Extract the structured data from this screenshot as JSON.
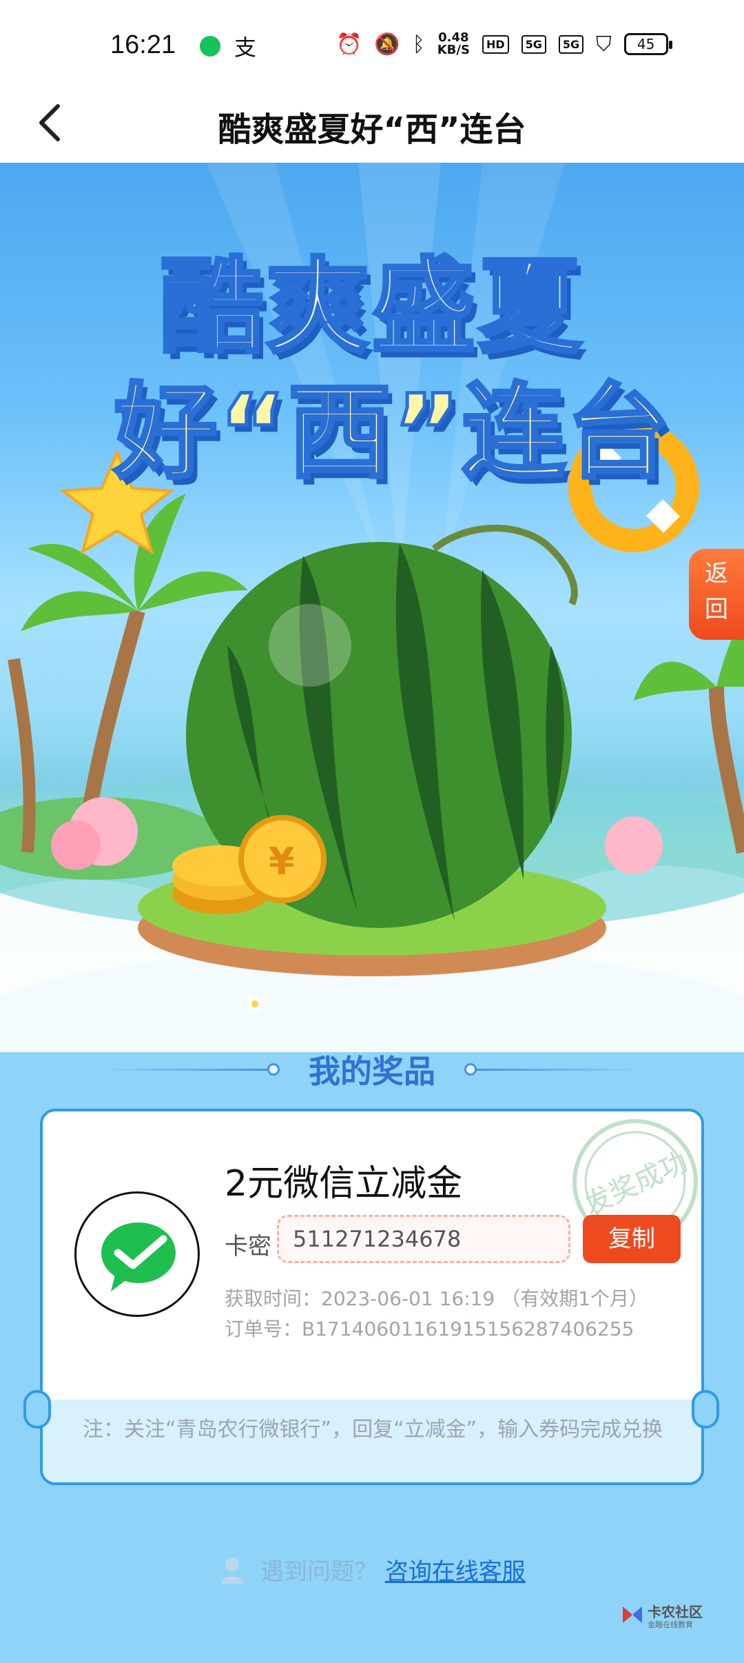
{
  "status_bar": {
    "time": "16:21",
    "pay_glyph": "支",
    "speed_value": "0.48",
    "speed_unit": "KB/S",
    "hd_badge": "HD",
    "net1": "5G",
    "net2": "5G",
    "battery": "45"
  },
  "nav": {
    "title": "酷爽盛夏好“西”连台"
  },
  "hero": {
    "title_line1": "酷爽盛夏",
    "title_line2": "好“西”连台",
    "return_label": "返回",
    "coin_symbol": "¥"
  },
  "prizes": {
    "heading": "我的奖品",
    "card": {
      "name": "2元微信立减金",
      "code_label": "卡密",
      "code_value": "511271234678",
      "copy_label": "复制",
      "time_line": "获取时间：2023-06-01 16:19 （有效期1个月）",
      "order_line": "订单号：B17140601161915156287406255",
      "stamp_text": "发奖成功",
      "note": "注：关注“青岛农行微银行”，回复“立减金”，输入券码完成兑换"
    }
  },
  "help": {
    "question": "遇到问题？",
    "link": "咨询在线客服"
  },
  "watermark": {
    "text": "卡农社区",
    "sub": "金融在线教育"
  },
  "colors": {
    "brand_blue": "#2f9ae8",
    "accent_red": "#ee4a1f",
    "wechat_green": "#1fbf4f"
  }
}
